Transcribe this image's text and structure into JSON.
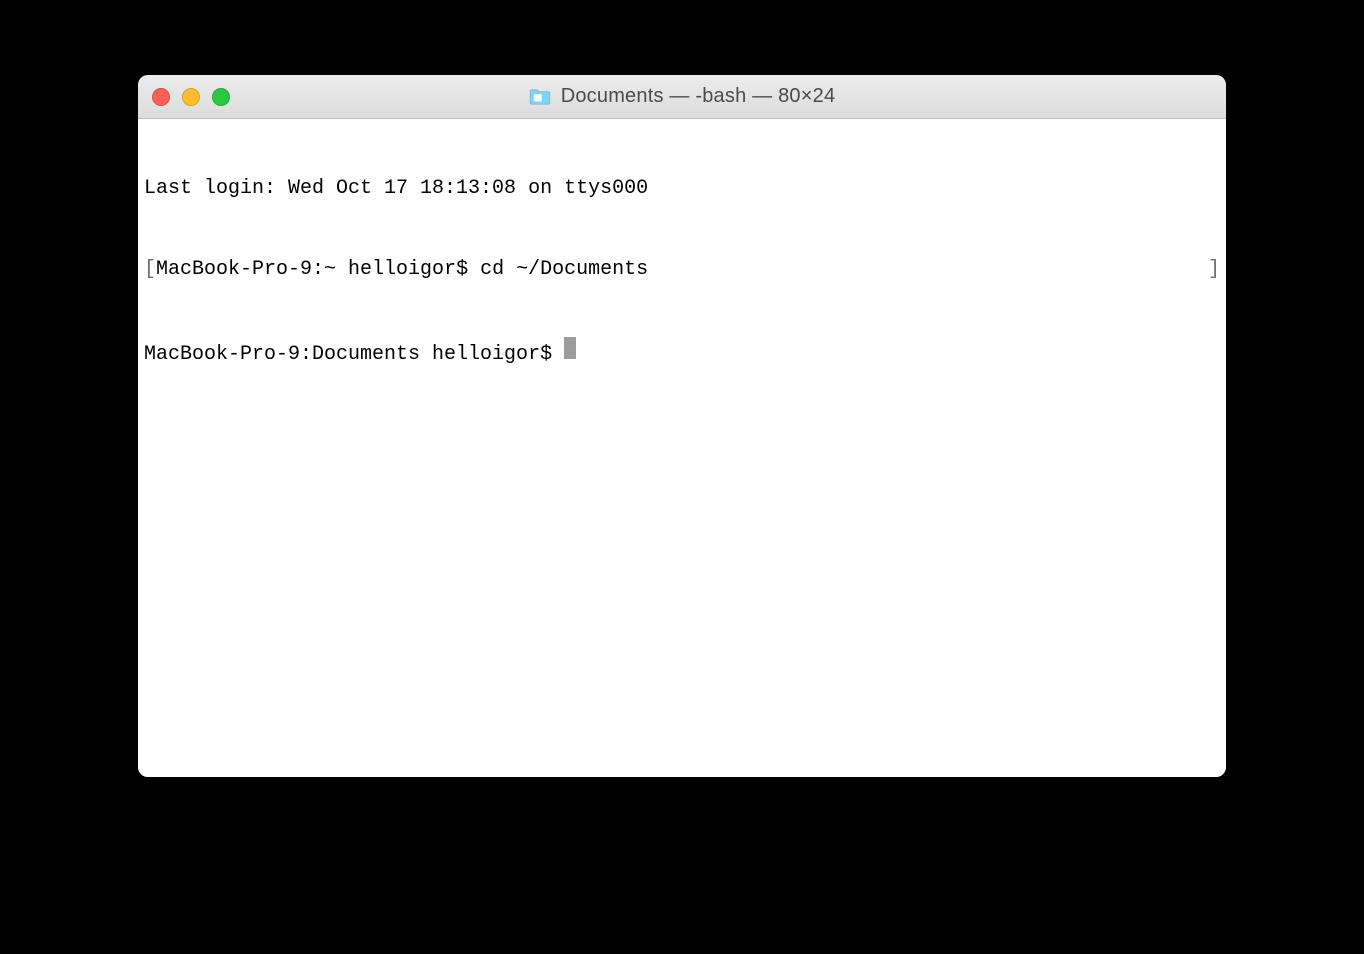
{
  "window": {
    "title": "Documents — -bash — 80×24"
  },
  "terminal": {
    "line1": "Last login: Wed Oct 17 18:13:08 on ttys000",
    "line2_prefix": "[",
    "line2_prompt": "MacBook-Pro-9:~ helloigor$ ",
    "line2_command": "cd ~/Documents",
    "line2_suffix": "]",
    "line3_prompt": "MacBook-Pro-9:Documents helloigor$ "
  }
}
